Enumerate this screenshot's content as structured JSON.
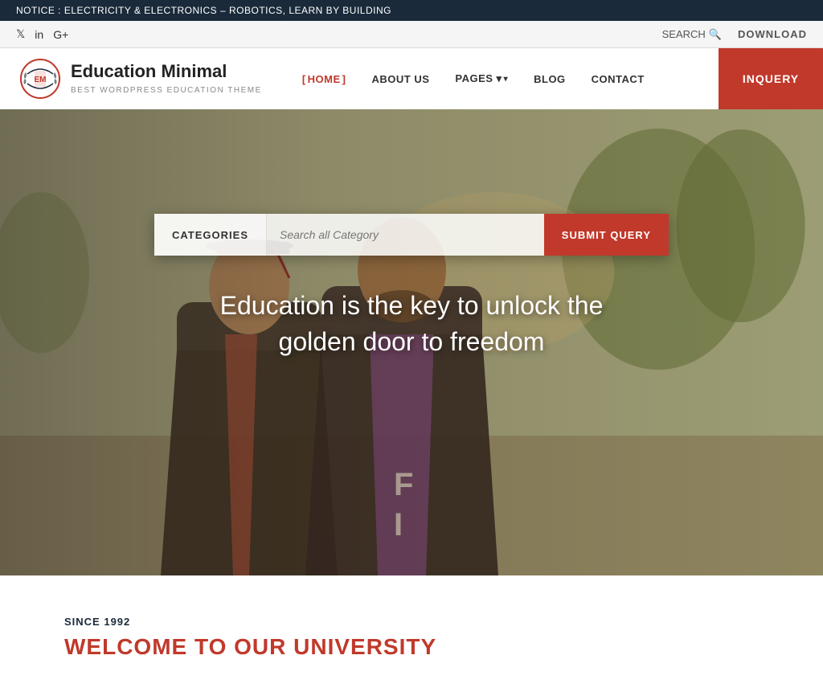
{
  "notice": {
    "text": "NOTICE :  ELECTRICITY & ELECTRONICS – ROBOTICS, LEARN BY BUILDING"
  },
  "social": {
    "icons": [
      {
        "name": "twitter",
        "symbol": "𝕏"
      },
      {
        "name": "linkedin",
        "symbol": "in"
      },
      {
        "name": "google-plus",
        "symbol": "G+"
      }
    ],
    "search_label": "SEARCH",
    "download_label": "DOWNLOAD"
  },
  "header": {
    "logo": {
      "initials": "EM",
      "title": "Education Minimal",
      "subtitle": "BEST WORDPRESS EDUCATION THEME"
    },
    "nav": [
      {
        "id": "home",
        "label": "HOME",
        "active": true,
        "dropdown": false
      },
      {
        "id": "about",
        "label": "ABOUT US",
        "active": false,
        "dropdown": false
      },
      {
        "id": "pages",
        "label": "PAGES",
        "active": false,
        "dropdown": true
      },
      {
        "id": "blog",
        "label": "BLOG",
        "active": false,
        "dropdown": false
      },
      {
        "id": "contact",
        "label": "CONTACT",
        "active": false,
        "dropdown": false
      }
    ],
    "inquery_btn": "INQUERY"
  },
  "hero": {
    "search": {
      "categories_btn": "CATEGORIES",
      "input_placeholder": "Search all Category",
      "submit_btn": "SUBMIT QUERY"
    },
    "tagline": "Education is the key to unlock the golden door to freedom"
  },
  "below_hero": {
    "since_label": "SINCE 1992",
    "welcome_title": "WELCOME TO OUR UNIVERSITY"
  }
}
